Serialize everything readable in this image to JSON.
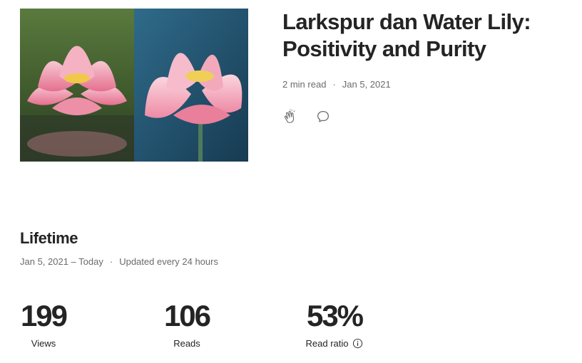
{
  "story": {
    "title": "Larkspur dan Water Lily: Positivity and Purity",
    "read_time": "2 min read",
    "separator": "·",
    "date": "Jan 5, 2021",
    "thumbnail_icon": "lotus-flowers-image"
  },
  "actions": {
    "clap_icon": "clap-icon",
    "comment_icon": "comment-icon"
  },
  "lifetime": {
    "heading": "Lifetime",
    "range": "Jan 5, 2021 – Today",
    "separator": "·",
    "updated": "Updated every 24 hours"
  },
  "stats": {
    "views": {
      "value": "199",
      "label": "Views"
    },
    "reads": {
      "value": "106",
      "label": "Reads"
    },
    "read_ratio": {
      "value": "53%",
      "label": "Read ratio",
      "icon": "info-icon"
    }
  },
  "colors": {
    "text": "#242424",
    "muted": "#6b6b6b",
    "background": "#ffffff"
  }
}
